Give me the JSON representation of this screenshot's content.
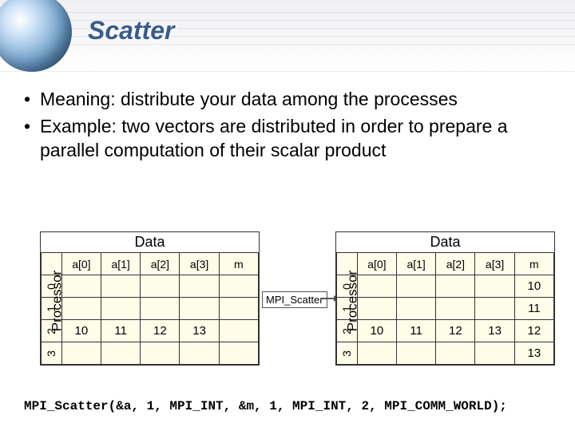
{
  "title": "Scatter",
  "bullets": [
    "Meaning: distribute your data among the processes",
    "Example: two vectors are distributed in order to prepare a parallel computation of their scalar product"
  ],
  "figure": {
    "left": {
      "data_label": "Data",
      "proc_label": "Processor",
      "headers": [
        "a[0]",
        "a[1]",
        "a[2]",
        "a[3]",
        "m"
      ],
      "rows": [
        {
          "proc": "0",
          "cells": [
            "",
            "",
            "",
            "",
            ""
          ]
        },
        {
          "proc": "1",
          "cells": [
            "",
            "",
            "",
            "",
            ""
          ]
        },
        {
          "proc": "2",
          "cells": [
            "10",
            "11",
            "12",
            "13",
            ""
          ]
        },
        {
          "proc": "3",
          "cells": [
            "",
            "",
            "",
            "",
            ""
          ]
        }
      ]
    },
    "arrow_label": "MPI_Scatter",
    "right": {
      "data_label": "Data",
      "proc_label": "Processor",
      "headers": [
        "a[0]",
        "a[1]",
        "a[2]",
        "a[3]",
        "m"
      ],
      "rows": [
        {
          "proc": "0",
          "cells": [
            "",
            "",
            "",
            "",
            "10"
          ]
        },
        {
          "proc": "1",
          "cells": [
            "",
            "",
            "",
            "",
            "11"
          ]
        },
        {
          "proc": "2",
          "cells": [
            "10",
            "11",
            "12",
            "13",
            "12"
          ]
        },
        {
          "proc": "3",
          "cells": [
            "",
            "",
            "",
            "",
            "13"
          ]
        }
      ]
    }
  },
  "code": "MPI_Scatter(&a, 1, MPI_INT, &m, 1, MPI_INT, 2, MPI_COMM_WORLD);"
}
